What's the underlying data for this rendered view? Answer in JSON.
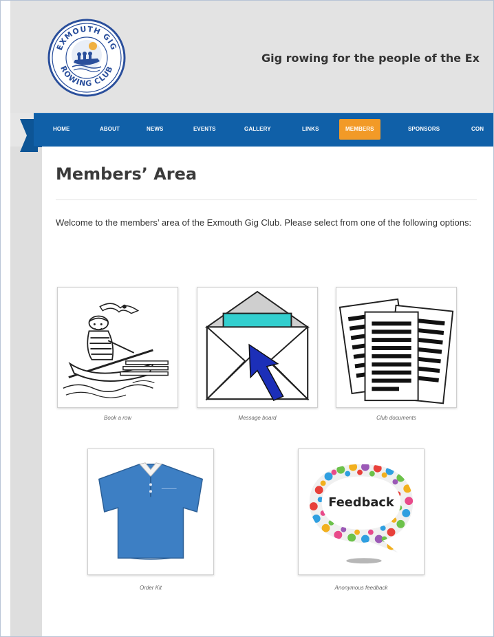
{
  "header": {
    "logo_text_top": "EXMOUTH GIG",
    "logo_text_bottom": "ROWING CLUB",
    "tagline": "Gig rowing for the people of the Ex"
  },
  "nav": {
    "items": [
      "HOME",
      "ABOUT",
      "NEWS",
      "EVENTS",
      "GALLERY",
      "LINKS",
      "MEMBERS",
      "SPONSORS",
      "CON"
    ],
    "active": "MEMBERS"
  },
  "main": {
    "title": "Members’ Area",
    "intro": "Welcome to the members’ area of the Exmouth Gig Club. Please select from one of the following options:",
    "options": [
      {
        "caption": "Book a row",
        "icon": "rower-icon"
      },
      {
        "caption": "Message board",
        "icon": "envelope-icon"
      },
      {
        "caption": "Club documents",
        "icon": "documents-icon"
      },
      {
        "caption": "Order Kit",
        "icon": "polo-shirt-icon"
      },
      {
        "caption": "Anonymous feedback",
        "icon": "feedback-bubble-icon",
        "bubble_text": "Feedback"
      }
    ]
  },
  "colors": {
    "nav_bg": "#1060a8",
    "nav_active": "#f29a27",
    "logo_blue": "#2a4f9c"
  }
}
